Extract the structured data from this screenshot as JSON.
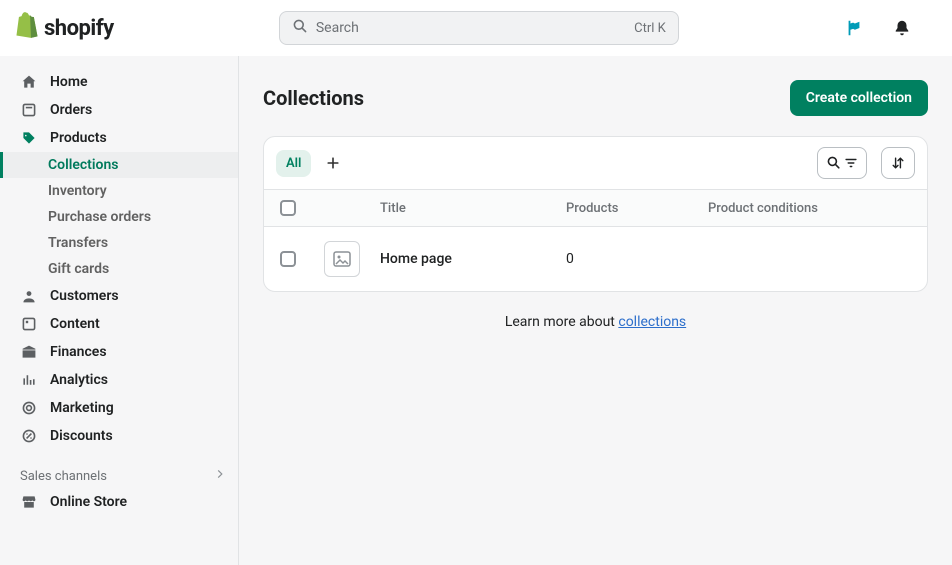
{
  "brand": {
    "name": "shopify"
  },
  "search": {
    "placeholder": "Search",
    "shortcut": "Ctrl K"
  },
  "sidebar": {
    "primary": [
      {
        "label": "Home",
        "icon": "home-icon"
      },
      {
        "label": "Orders",
        "icon": "orders-icon"
      },
      {
        "label": "Products",
        "icon": "products-icon",
        "expanded": true,
        "children": [
          {
            "label": "Collections",
            "active": true
          },
          {
            "label": "Inventory"
          },
          {
            "label": "Purchase orders"
          },
          {
            "label": "Transfers"
          },
          {
            "label": "Gift cards"
          }
        ]
      },
      {
        "label": "Customers",
        "icon": "customers-icon"
      },
      {
        "label": "Content",
        "icon": "content-icon"
      },
      {
        "label": "Finances",
        "icon": "finances-icon"
      },
      {
        "label": "Analytics",
        "icon": "analytics-icon"
      },
      {
        "label": "Marketing",
        "icon": "marketing-icon"
      },
      {
        "label": "Discounts",
        "icon": "discounts-icon"
      }
    ],
    "sales_channels_label": "Sales channels",
    "sales_channels": [
      {
        "label": "Online Store",
        "icon": "store-icon"
      }
    ]
  },
  "page": {
    "title": "Collections",
    "create_button": "Create collection",
    "views": {
      "all": "All"
    },
    "columns": {
      "title": "Title",
      "products": "Products",
      "conditions": "Product conditions"
    },
    "rows": [
      {
        "title": "Home page",
        "products": "0",
        "conditions": ""
      }
    ],
    "learn_prefix": "Learn more about ",
    "learn_link": "collections"
  }
}
